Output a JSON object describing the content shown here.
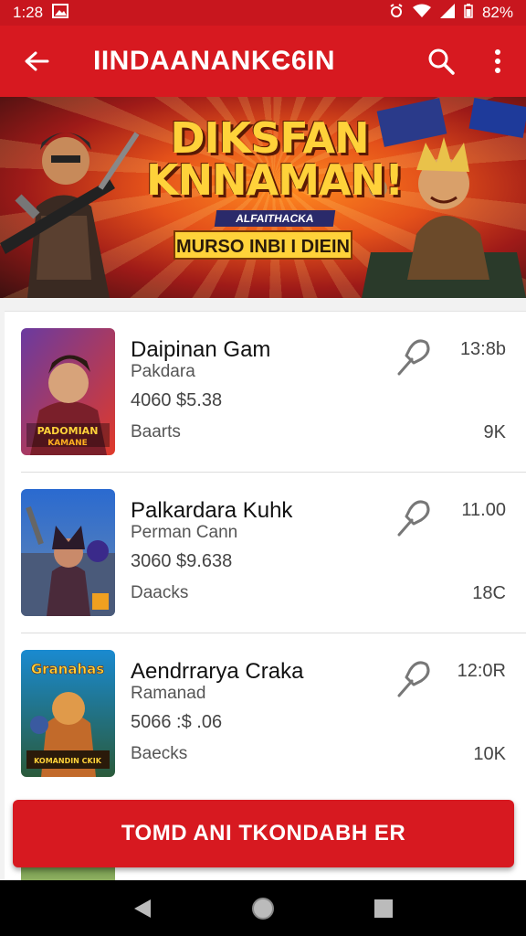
{
  "status_bar": {
    "time": "1:28",
    "battery": "82%"
  },
  "app_bar": {
    "title": "IINDAANANKЄ6IN"
  },
  "banner": {
    "title_line1": "DIKSFAN",
    "title_line2": "KNNAMAN!",
    "subtitle": "ALFAITHACKA",
    "tagline": "MURSO INBI I DIEIN",
    "dots_total": 4,
    "dots_active_index": 3
  },
  "items": [
    {
      "name": "Daipinan Gam",
      "developer": "Pakdara",
      "price": "4060  $5.38",
      "category": "Baarts",
      "time": "13:8b",
      "count": "9K",
      "thumb_text": "PADOMIAN KAMANE"
    },
    {
      "name": "Palkardara Kuhk",
      "developer": "Perman Cann",
      "price": "3060  $9.638",
      "category": "Daacks",
      "time": "11.00",
      "count": "18C"
    },
    {
      "name": "Aendrrarya Craka",
      "developer": "Ramanad",
      "price": "5066  :$ .06",
      "category": "Baecks",
      "time": "12:0R",
      "count": "10K",
      "thumb_text": "Granahas",
      "thumb_banner": "KOMANDIN CKIK"
    }
  ],
  "cta": {
    "label": "TOMD ANI TKONDABH ER"
  },
  "colors": {
    "primary": "#d71920",
    "status_bar": "#c8161e",
    "text_dark": "#111111",
    "text_muted": "#555555"
  },
  "icons": [
    "back-arrow-icon",
    "search-icon",
    "more-vert-icon",
    "pin-icon",
    "nav-back-icon",
    "nav-home-icon",
    "nav-recents-icon"
  ]
}
